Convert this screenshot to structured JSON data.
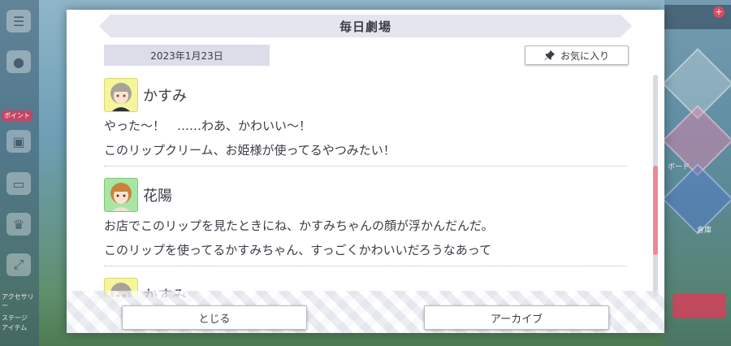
{
  "window": {
    "title": "毎日劇場"
  },
  "header": {
    "date": "2023年1月23日",
    "favorite_label": "お気に入り"
  },
  "log": {
    "entries": [
      {
        "speaker": "かすみ",
        "avatar_color": "#f6f59a",
        "lines": [
          "やった～！　……わあ、かわいい～！",
          "このリップクリーム、お姫様が使ってるやつみたい！"
        ]
      },
      {
        "speaker": "花陽",
        "avatar_color": "#a8e6a4",
        "lines": [
          "お店でこのリップを見たときにね、かすみちゃんの顔が浮かんだんだ。",
          "このリップを使ってるかすみちゃん、すっごくかわいいだろうなあって"
        ]
      },
      {
        "speaker": "かすみ",
        "avatar_color": "#f6f59a",
        "lines": []
      }
    ]
  },
  "footer": {
    "close_label": "とじる",
    "archive_label": "アーカイブ"
  },
  "background": {
    "left_badge": "ポイント",
    "left_labels": [
      "アクセサリー",
      "ステージ",
      "アイテム"
    ],
    "right_labels": [
      "ボード",
      "倉庫"
    ]
  },
  "colors": {
    "scroll_thumb": "#ec8a96",
    "title_bar": "#e4e5ee",
    "date_box": "#dcdde8"
  }
}
